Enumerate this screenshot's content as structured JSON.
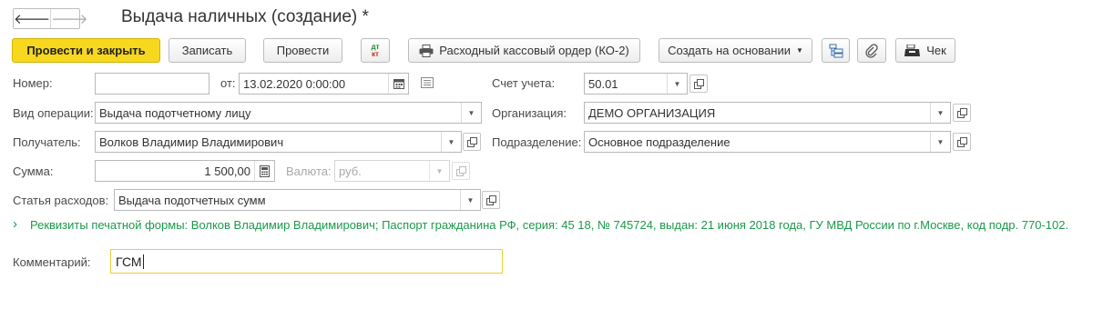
{
  "nav": {
    "back_icon": "arrow-left-icon",
    "forward_icon": "arrow-right-icon"
  },
  "window": {
    "title": "Выдача наличных (создание) *"
  },
  "toolbar": {
    "post_and_close": "Провести и закрыть",
    "save": "Записать",
    "post": "Провести",
    "dt_kt_top": "дт",
    "dt_kt_bottom": "кт",
    "print_order": "Расходный кассовый ордер (КО-2)",
    "create_based_on": "Создать на основании",
    "receipt": "Чек",
    "accent_color": "#f7d81f"
  },
  "form": {
    "number": {
      "label": "Номер:",
      "value": ""
    },
    "date": {
      "label": "от:",
      "value": "13.02.2020  0:00:00"
    },
    "account": {
      "label": "Счет учета:",
      "value": "50.01"
    },
    "operation": {
      "label": "Вид операции:",
      "value": "Выдача подотчетному лицу"
    },
    "organization": {
      "label": "Организация:",
      "value": "ДЕМО ОРГАНИЗАЦИЯ"
    },
    "recipient": {
      "label": "Получатель:",
      "value": "Волков Владимир Владимирович"
    },
    "department": {
      "label": "Подразделение:",
      "value": "Основное подразделение"
    },
    "amount": {
      "label": "Сумма:",
      "value": "1 500,00"
    },
    "currency": {
      "label": "Валюта:",
      "value": "руб."
    },
    "expense_item": {
      "label": "Статья расходов:",
      "value": "Выдача подотчетных сумм"
    },
    "print_details": "Реквизиты печатной формы: Волков Владимир Владимирович; Паспорт гражданина РФ, серия: 45 18, № 745724, выдан: 21 июня 2018 года, ГУ МВД России по г.Москве, код подр. 770-102.",
    "comment": {
      "label": "Комментарий:",
      "value": "ГСМ"
    }
  }
}
